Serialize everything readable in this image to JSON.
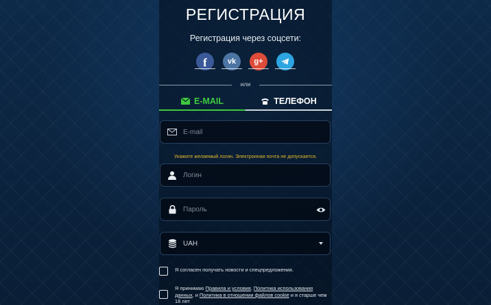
{
  "header": {
    "title": "РЕГИСТРАЦИЯ"
  },
  "social": {
    "title": "Регистрация через соцсети:",
    "items": [
      {
        "name": "facebook",
        "glyph": "f",
        "color": "#3b5998"
      },
      {
        "name": "vkontakte",
        "glyph": "vk",
        "color": "#4c75a3"
      },
      {
        "name": "google-plus",
        "glyph": "g+",
        "color": "#dd4b39"
      },
      {
        "name": "telegram",
        "glyph": "telegram-plane",
        "color": "#2ca5e0"
      }
    ]
  },
  "divider": {
    "label": "или"
  },
  "tabs": [
    {
      "label": "E-MAIL",
      "active": true,
      "icon": "envelope-icon",
      "color": "#3ecb3e"
    },
    {
      "label": "ТЕЛЕФОН",
      "active": false,
      "icon": "phone-icon",
      "color": "#ffffff"
    }
  ],
  "form": {
    "email": {
      "placeholder": "E-mail",
      "value": ""
    },
    "hint": "Укажите желаемый логин. Электронная почта не допускается.",
    "login": {
      "placeholder": "Логин",
      "value": ""
    },
    "password": {
      "placeholder": "Пароль",
      "value": ""
    },
    "currency": {
      "value": "UAH"
    }
  },
  "consents": {
    "news": "Я согласен получать новости и спецпредложения.",
    "terms": {
      "prefix": "Я принимаю ",
      "link1": "Правила и условия",
      "sep1": ", ",
      "link2": "Политика использования данных",
      "sep2": ", и ",
      "link3": "Политика в отношении файлов cookie",
      "suffix": " и я старше чем 18 лет"
    }
  }
}
